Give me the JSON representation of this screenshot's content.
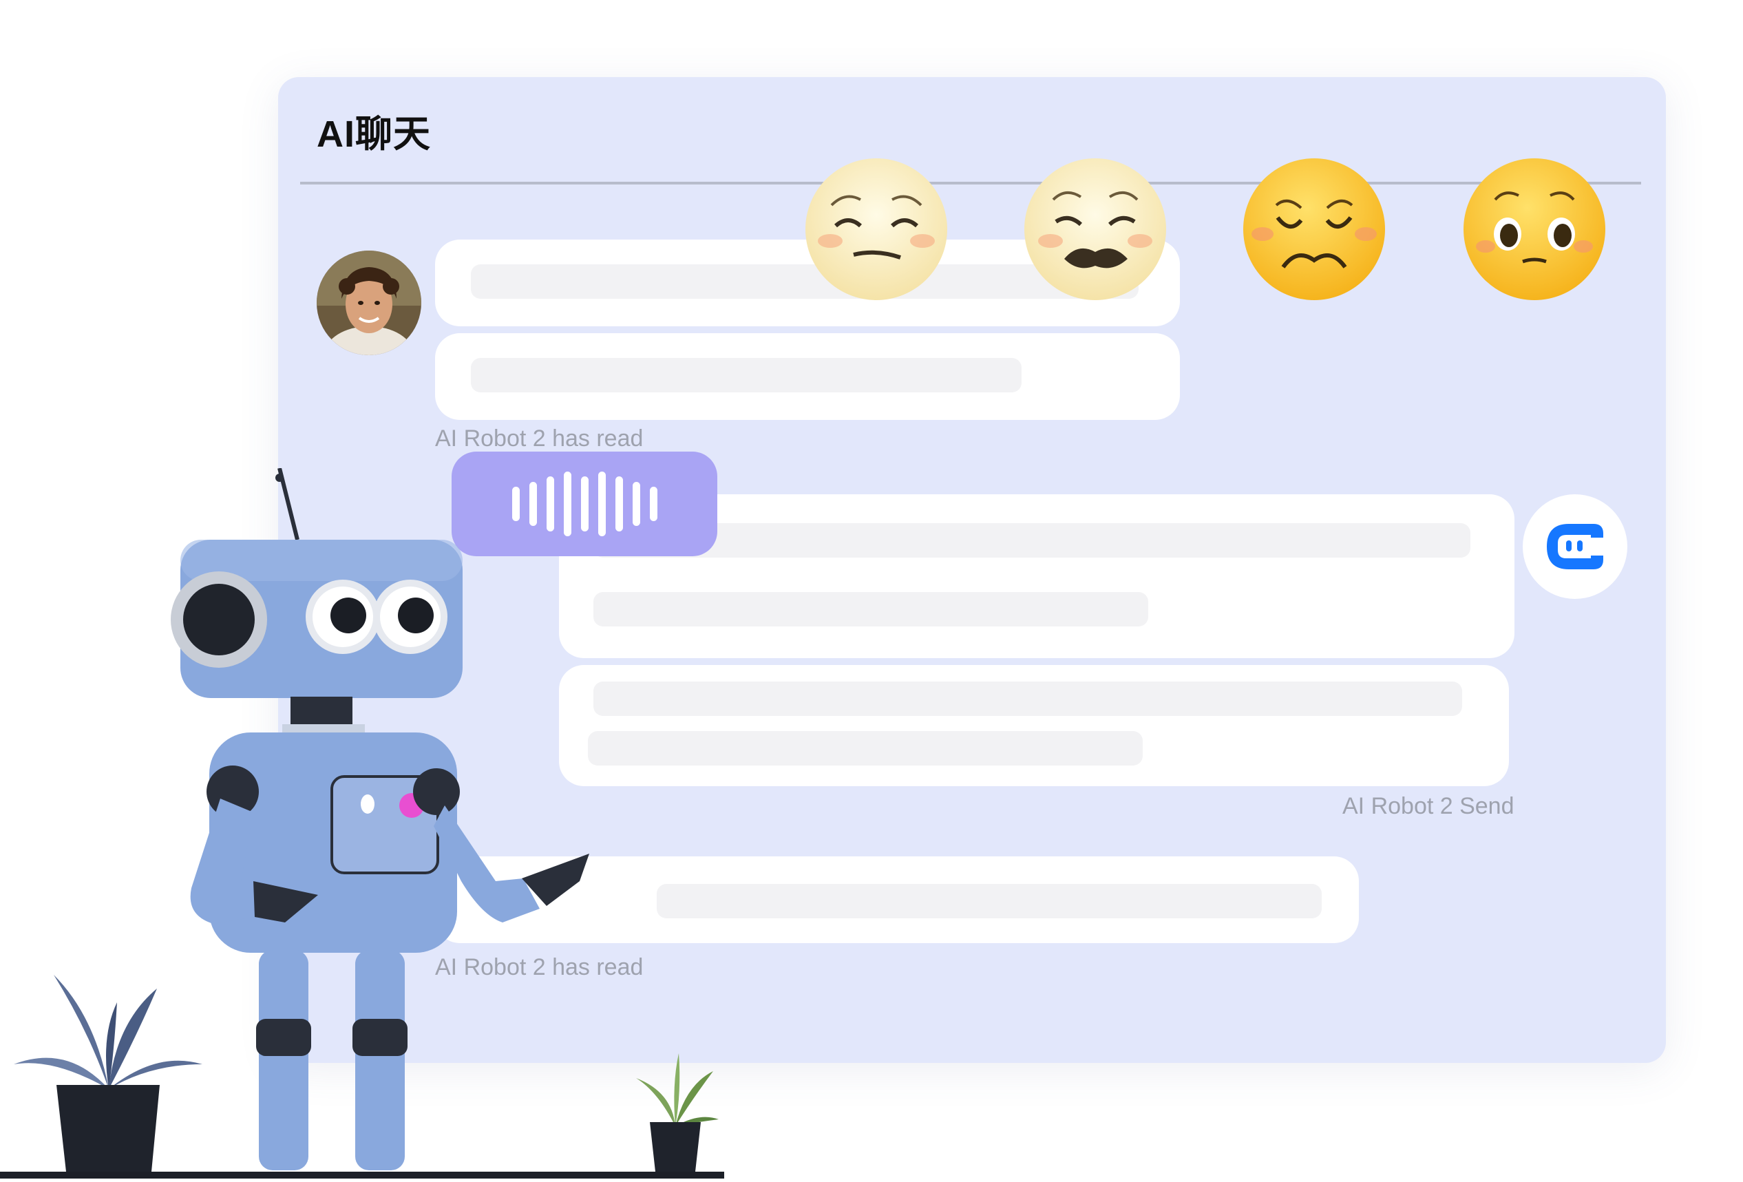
{
  "app": {
    "title": "AI聊天"
  },
  "messages": {
    "user_read_status": "AI Robot 2 has read",
    "bot_send_status": "AI Robot 2 Send",
    "user_read_status_2": "AI Robot 2 has read"
  },
  "emojis": [
    "weary-face-icon",
    "crying-face-icon",
    "anguished-face-icon",
    "pleading-face-icon"
  ],
  "colors": {
    "panel": "#e2e7fb",
    "voice_bubble": "#a9a4f4",
    "bot_brand": "#1677ff",
    "accent_emoji": "#ffc61e"
  }
}
